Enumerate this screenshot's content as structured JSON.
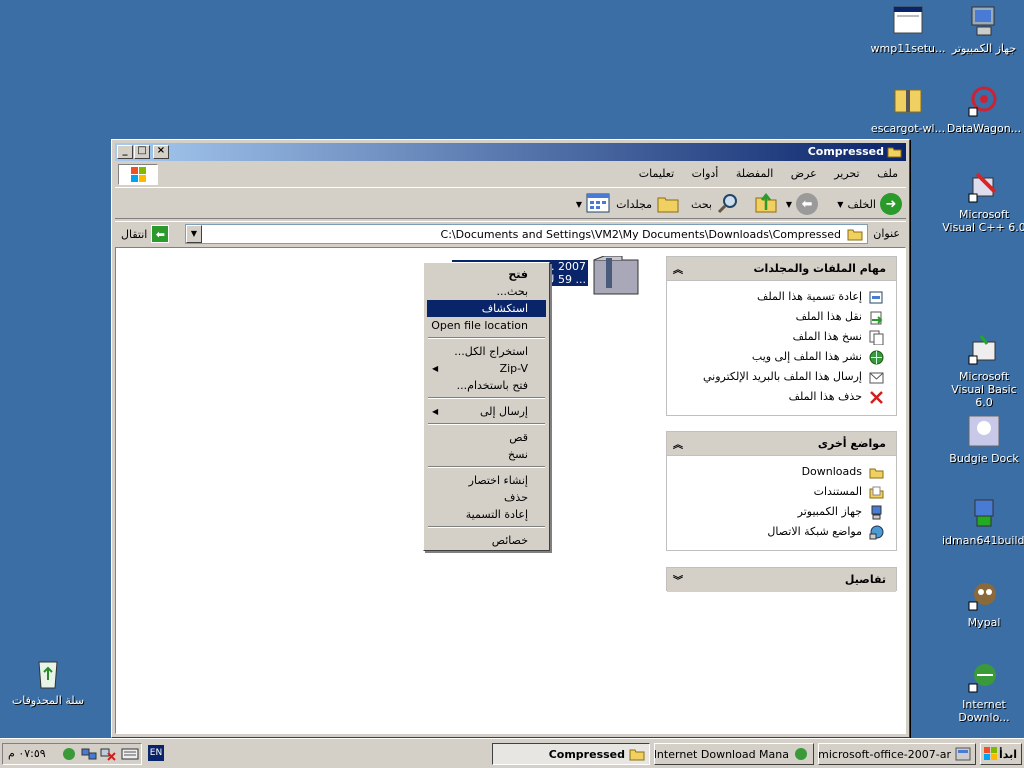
{
  "desktop": {
    "icons": [
      {
        "label": "wmp11setu..."
      },
      {
        "label": "جهاز الكمبيوتر"
      },
      {
        "label": "escargot-wl..."
      },
      {
        "label": "DataWagon..."
      },
      {
        "label": "Microsoft Visual C++ 6.0"
      },
      {
        "label": "Microsoft Visual Basic 6.0"
      },
      {
        "label": "Budgie Dock"
      },
      {
        "label": "idman641build2"
      },
      {
        "label": "Mypal"
      },
      {
        "label": "Internet Downlo..."
      },
      {
        "label": "سلة المحذوفات"
      }
    ]
  },
  "window": {
    "title": "Compressed",
    "menu": [
      "ملف",
      "تحرير",
      "عرض",
      "المفضلة",
      "أدوات",
      "تعليمات"
    ],
    "toolbar": {
      "back": "الخلف",
      "search": "بحث",
      "folders": "مجلدات"
    },
    "address": {
      "label": "عنوان",
      "value": "C:\\Documents and Settings\\VM2\\My Documents\\Downloads\\Compressed",
      "go": "انتقال"
    }
  },
  "file": {
    "name_line1": "Arabic ... 2007",
    "name_line2": "... 59 ك.ب"
  },
  "panels": {
    "tasks": {
      "title": "مهام الملفات والمجلدات",
      "items": [
        "إعادة تسمية هذا الملف",
        "نقل هذا الملف",
        "نسخ هذا الملف",
        "نشر هذا الملف إلى ويب",
        "إرسال هذا الملف بالبريد الإلكتروني",
        "حذف هذا الملف"
      ]
    },
    "places": {
      "title": "مواضع أخرى",
      "items": [
        "Downloads",
        "المستندات",
        "جهاز الكمبيوتر",
        "مواضع شبكة الاتصال"
      ]
    },
    "details": {
      "title": "تفاصيل"
    }
  },
  "context_menu": {
    "open": "فتح",
    "search": "بحث...",
    "explore": "استكشاف",
    "open_location": "Open file location",
    "extract_all": "استخراج الكل...",
    "zipv": "Zip-V",
    "open_with": "فتح باستخدام...",
    "send_to": "إرسال إلى",
    "cut": "قص",
    "copy": "نسخ",
    "shortcut": "إنشاء اختصار",
    "delete": "حذف",
    "rename": "إعادة التسمية",
    "properties": "خصائص"
  },
  "taskbar": {
    "start": "ابدأ",
    "tasks": [
      {
        "label": "...microsoft-office-2007-ar"
      },
      {
        "label": "...Internet Download Mana"
      },
      {
        "label": "Compressed"
      }
    ],
    "lang": "EN",
    "clock": "٠٧:٥٩ م"
  }
}
